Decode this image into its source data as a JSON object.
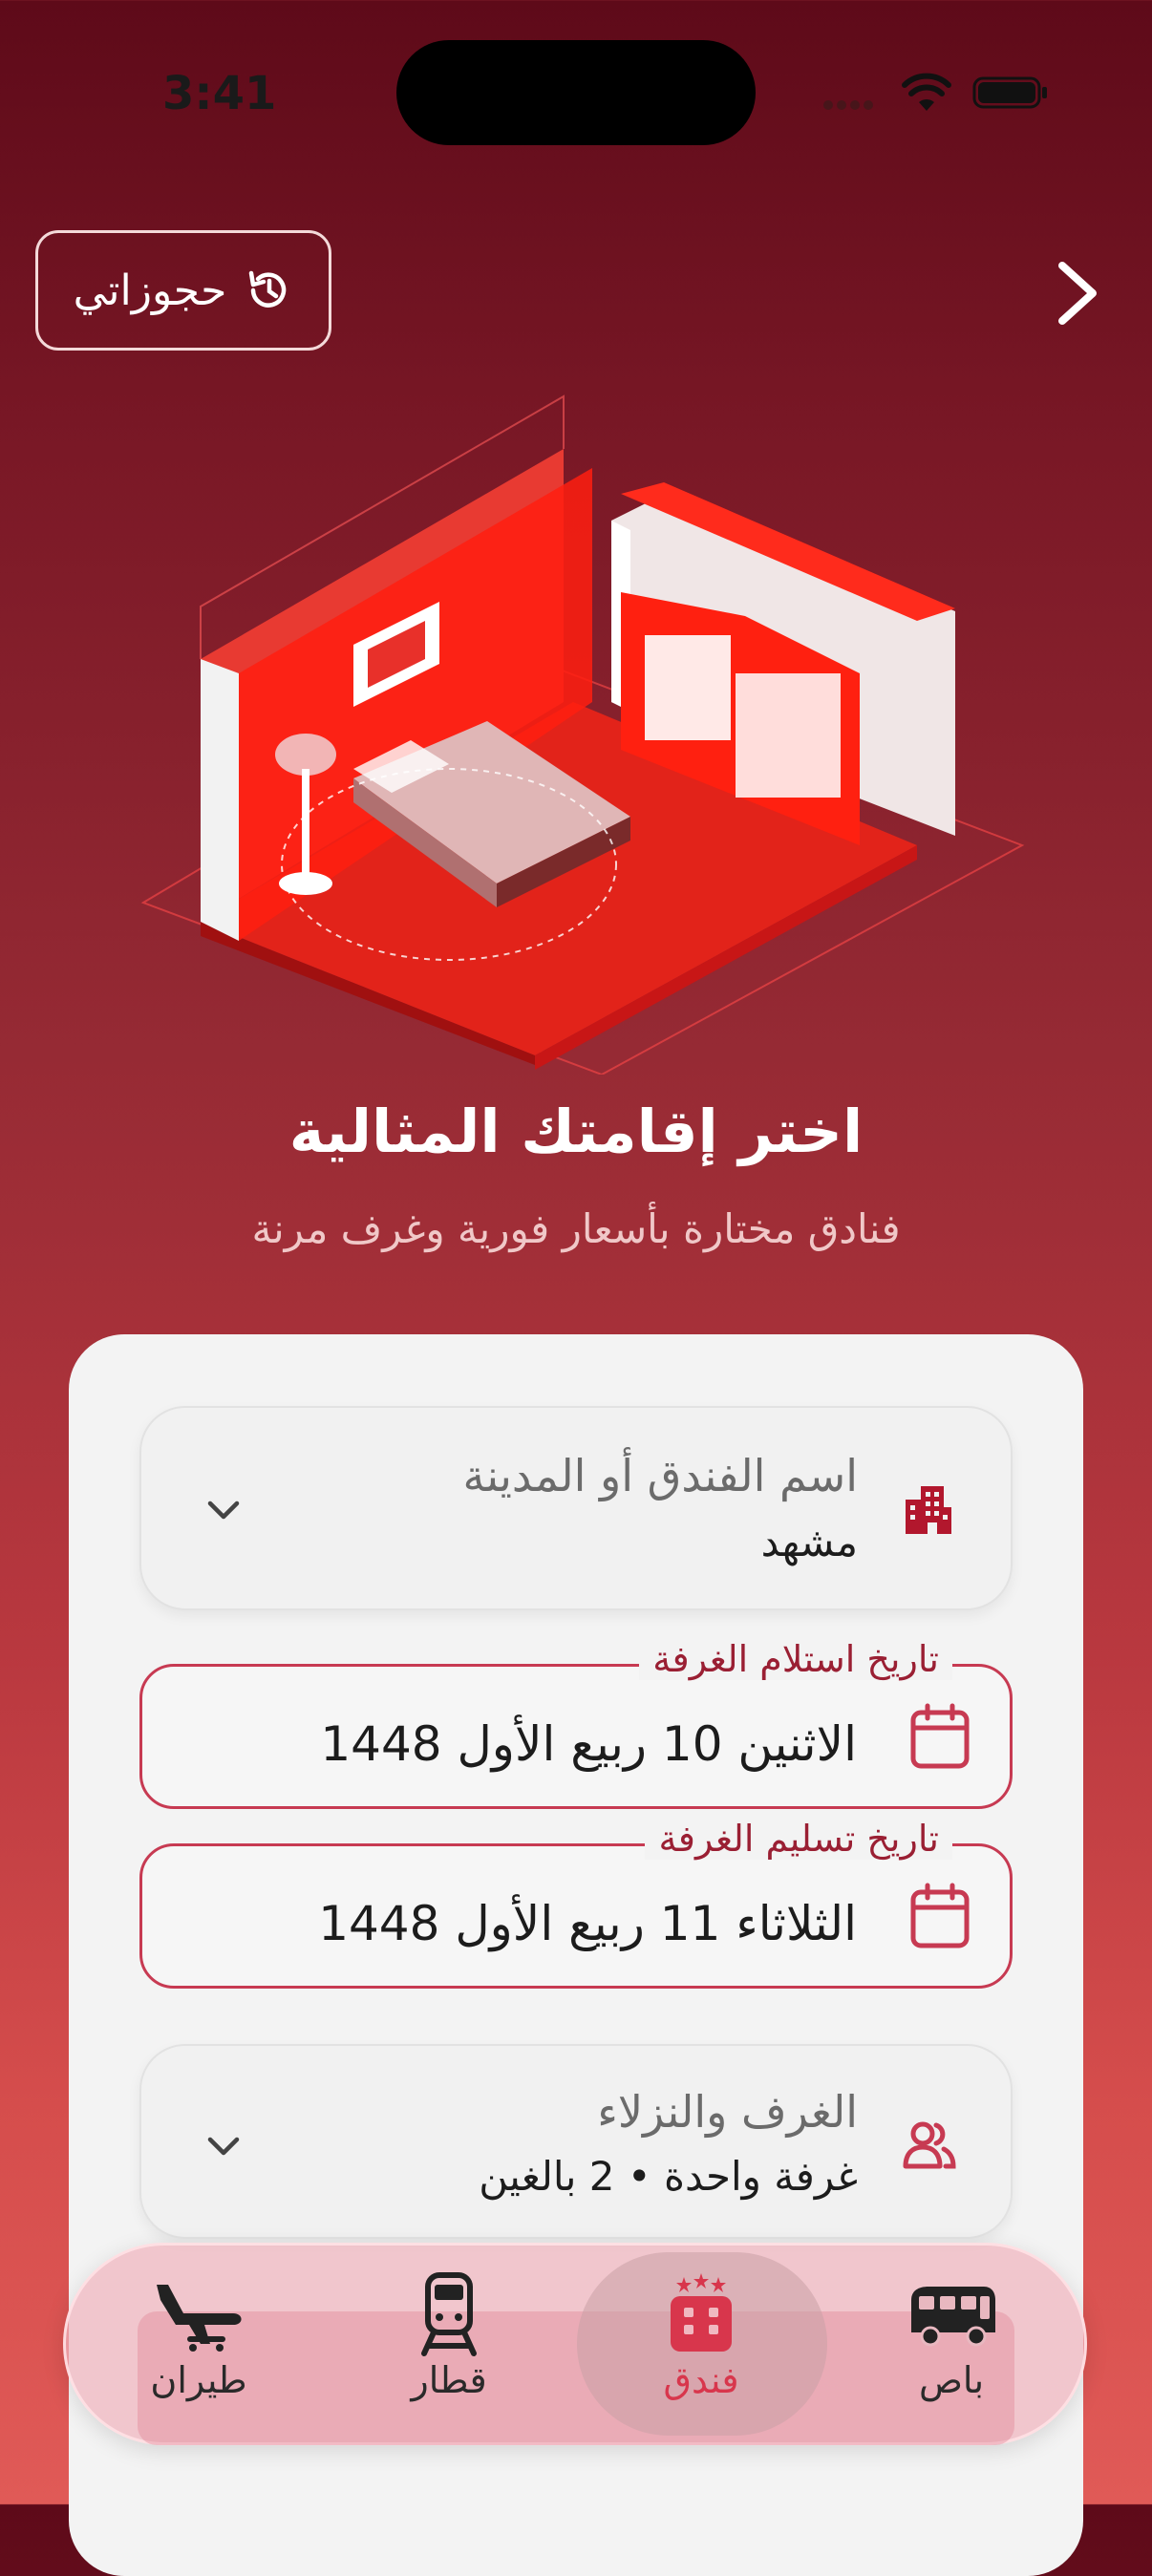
{
  "status_bar": {
    "time": "3:41"
  },
  "header": {
    "bookings_label": "حجوزاتي"
  },
  "hero": {
    "title": "اختر إقامتك المثالية",
    "subtitle": "فنادق مختارة بأسعار فورية وغرف مرنة"
  },
  "form": {
    "hotel": {
      "label": "اسم الفندق أو المدينة",
      "value": "مشهد"
    },
    "checkin": {
      "label": "تاريخ استلام الغرفة",
      "value": "الاثنين 10 ربيع الأول 1448"
    },
    "checkout": {
      "label": "تاريخ تسليم الغرفة",
      "value": "الثلاثاء 11 ربيع الأول 1448"
    },
    "guests": {
      "label": "الغرف والنزلاء",
      "value": "غرفة واحدة • 2 بالغين"
    }
  },
  "nav": {
    "items": [
      {
        "label": "طيران",
        "icon": "plane-icon"
      },
      {
        "label": "قطار",
        "icon": "train-icon"
      },
      {
        "label": "فندق",
        "icon": "hotel-icon",
        "active": true
      },
      {
        "label": "باص",
        "icon": "bus-icon"
      }
    ]
  },
  "colors": {
    "accent": "#d8364c",
    "brand_dark": "#5e0a19",
    "field_border": "#c73a52"
  }
}
